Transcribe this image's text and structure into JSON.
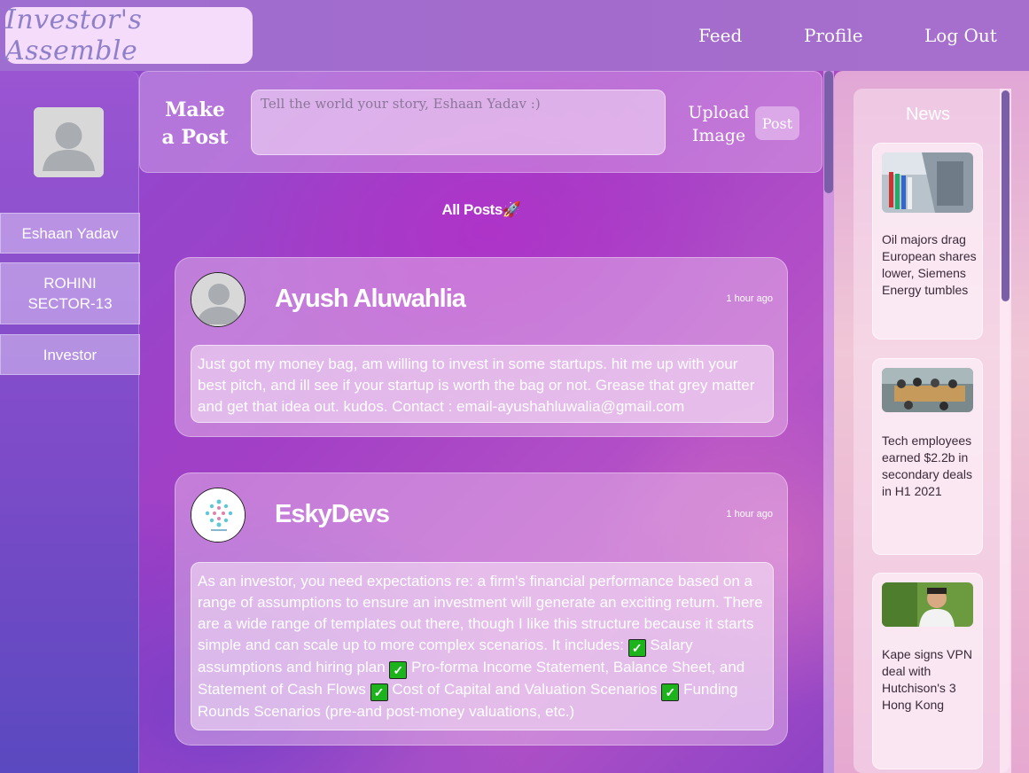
{
  "header": {
    "logo": "Investor's Assemble",
    "nav": [
      "Feed",
      "Profile",
      "Log Out"
    ]
  },
  "user": {
    "name": "Eshaan Yadav",
    "location": "ROHINI SECTOR-13",
    "role": "Investor"
  },
  "composer": {
    "label": "Make a Post",
    "placeholder": "Tell the world your story, Eshaan Yadav :)",
    "upload_label": "Upload Image",
    "post_label": "Post"
  },
  "feed": {
    "title": "All Posts🚀",
    "posts": [
      {
        "author": "Ayush Aluwahlia",
        "time": "1 hour ago",
        "body": "Just got my money bag, am willing to invest in some startups. hit me up with your best pitch, and ill see if your startup is worth the bag or not. Grease that grey matter and get that idea out. kudos. Contact : email-ayushahluwalia@gmail.com"
      },
      {
        "author": "EskyDevs",
        "time": "1 hour ago",
        "body_parts": [
          "As an investor, you need expectations re: a firm's financial performance based on a range of assumptions to ensure an investment will generate an exciting return. There are a wide range of templates out there, though I like this structure because it starts simple and can scale up to more complex scenarios. It includes: ",
          " Salary assumptions and hiring plan ",
          " Pro-forma Income Statement, Balance Sheet, and Statement of Cash Flows ",
          " Cost of Capital and Valuation Scenarios ",
          " Funding Rounds Scenarios (pre-and post-money valuations, etc.)"
        ]
      }
    ]
  },
  "news": {
    "title": "News",
    "items": [
      "Oil majors drag European shares lower, Siemens Energy tumbles",
      "Tech employees earned $2.2b in secondary deals in H1 2021",
      "Kape signs VPN deal with Hutchison's 3 Hong Kong"
    ]
  }
}
